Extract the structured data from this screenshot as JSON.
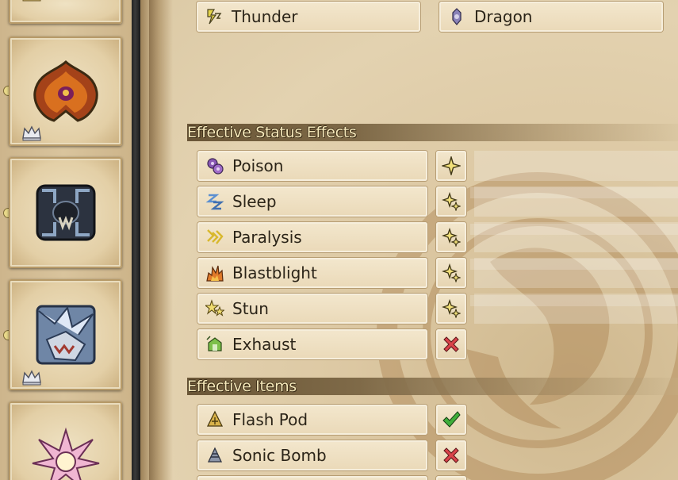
{
  "weakness": {
    "items": [
      {
        "label": "Thunder",
        "icon": "thunder-element-icon"
      },
      {
        "label": "Dragon",
        "icon": "dragon-element-icon"
      }
    ]
  },
  "status_section": {
    "title": "Effective Status Effects",
    "items": [
      {
        "label": "Poison",
        "icon": "poison-icon",
        "rating": "one-star"
      },
      {
        "label": "Sleep",
        "icon": "sleep-icon",
        "rating": "two-stars"
      },
      {
        "label": "Paralysis",
        "icon": "paralysis-icon",
        "rating": "two-stars"
      },
      {
        "label": "Blastblight",
        "icon": "blastblight-icon",
        "rating": "two-stars"
      },
      {
        "label": "Stun",
        "icon": "stun-icon",
        "rating": "two-stars"
      },
      {
        "label": "Exhaust",
        "icon": "exhaust-icon",
        "rating": "not-effective"
      }
    ]
  },
  "items_section": {
    "title": "Effective Items",
    "items": [
      {
        "label": "Flash Pod",
        "icon": "flash-pod-icon",
        "rating": "effective"
      },
      {
        "label": "Sonic Bomb",
        "icon": "sonic-bomb-icon",
        "rating": "not-effective"
      }
    ]
  },
  "colors": {
    "check": "#3fae3a",
    "cross": "#d9434a",
    "star": "#f2e07a",
    "header_text": "#f4e7b9"
  }
}
